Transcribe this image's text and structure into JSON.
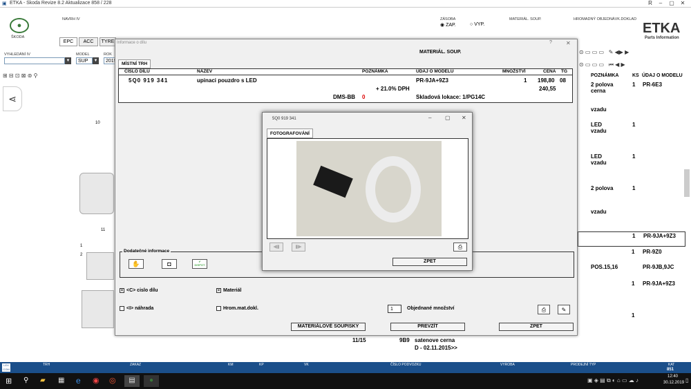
{
  "app": {
    "title": "ETKA - Skoda Revize 8.2 Aktualizace 858 / 228",
    "brand": "ETKA",
    "brand_sub": "Parts Information",
    "skoda": "ŠKODA"
  },
  "header": {
    "navrh": "NAVRH IV",
    "zasoba": "ZÁSOBA",
    "zap": "ZAP.",
    "vyp": "VYP.",
    "material_soup": "MATERIÁL. SOUP.",
    "hromadny": "HROMADNÝ OBJEDNÁVK.DOKLAD"
  },
  "tabs": [
    "EPC",
    "ACC",
    "TYRE"
  ],
  "search": {
    "label": "VYHLEDÁNÍ IV",
    "model_label": "MODEL",
    "model": "SUP",
    "rok_label": "ROK",
    "rok": "2019"
  },
  "right_table": {
    "headers": [
      "POZNÁMKA",
      "KS",
      "ÚDAJ O MODELU"
    ],
    "rows": [
      [
        "2 polova cerna",
        "1",
        "PR-6E3"
      ],
      [
        "vzadu",
        "",
        ""
      ],
      [
        "LED vzadu",
        "1",
        ""
      ],
      [
        "LED vzadu",
        "1",
        ""
      ],
      [
        "2 polova",
        "1",
        ""
      ],
      [
        "vzadu",
        "",
        ""
      ],
      [
        "",
        "1",
        "PR-9JA+9Z3"
      ],
      [
        "",
        "1",
        "PR-9Z0"
      ],
      [
        "POS.15,16",
        "",
        "PR-9JB,9JC"
      ],
      [
        "",
        "1",
        "PR-9JA+9Z3"
      ],
      [
        "",
        "1",
        ""
      ]
    ]
  },
  "bottom_rows": {
    "r1a": "11/15",
    "r1b": "9B9",
    "r1c": "satenove cerna",
    "r2": "D - 02.11.2015>>"
  },
  "dialog": {
    "title": "Informace o dílu",
    "header": "MATERIÁL. SOUP.",
    "tab": "MÍSTNÍ TRH",
    "columns": [
      "ČÍSLO DÍLU",
      "NÁZEV",
      "POZNÁMKA",
      "ÚDAJ O MODELU",
      "MNOŽSTVÍ",
      "CENA",
      "TG"
    ],
    "part": {
      "number": "5Q0 919 341",
      "name": "upinaci pouzdro s LED",
      "model": "PR-9JA+9Z3",
      "qty": "1",
      "price": "198,80",
      "tg": "08",
      "dph": "+ 21.0% DPH",
      "price2": "240,55",
      "dms": "DMS-BB",
      "dms_val": "0",
      "lokace": "Skladová lokace: 1/PG14C"
    },
    "extra_label": "Dodatečné informace",
    "dispo": "DISPOT",
    "cb1": "<C> cislo dílu",
    "cb2": "Materiál",
    "cb3": "<I> náhrada",
    "cb4": "Hrom.mat.dokl.",
    "qty_label": "Objednané množství",
    "qty_value": "1",
    "btn1": "MATERIÁLOVÉ SOUPISKY",
    "btn2": "PREVZÍT",
    "btn3": "ZPET"
  },
  "photo": {
    "title": "5Q0 919 341",
    "tab": "FOTOGRAFOVÁNÍ",
    "back": "ZPET"
  },
  "status": {
    "labels": [
      "TRH",
      "ZAKAZ",
      "KM",
      "KP",
      "VK",
      "ČÍSLO PODVOZKU",
      "VYROBA",
      "PRODEJNÍ TYP",
      "KAT"
    ],
    "kat": "851"
  },
  "taskbar": {
    "time": "12:40",
    "date": "30.12.2019"
  }
}
